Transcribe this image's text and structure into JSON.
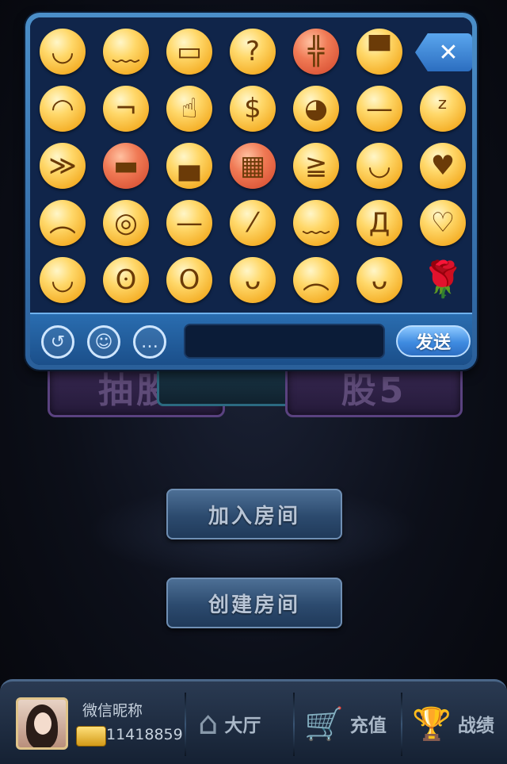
{
  "background": {
    "card_left_text": "抽股",
    "card_right_text": "股5"
  },
  "main": {
    "join_room_label": "加入房间",
    "create_room_label": "创建房间"
  },
  "emoji_panel": {
    "close_label": "✕",
    "emojis": [
      {
        "name": "smile",
        "glyph": "◡"
      },
      {
        "name": "embarrassed",
        "glyph": "﹏"
      },
      {
        "name": "scared",
        "glyph": "▭"
      },
      {
        "name": "confused",
        "glyph": "?"
      },
      {
        "name": "angry-crying",
        "glyph": "╬"
      },
      {
        "name": "vomit",
        "glyph": "▀"
      },
      {
        "name": "shy",
        "glyph": "◠"
      },
      {
        "name": "smug",
        "glyph": "¬"
      },
      {
        "name": "thumbs-up",
        "glyph": "☝"
      },
      {
        "name": "money-eyes",
        "glyph": "$"
      },
      {
        "name": "wink-grin",
        "glyph": "◕"
      },
      {
        "name": "sweat",
        "glyph": "—"
      },
      {
        "name": "sleepy",
        "glyph": "ᶻ"
      },
      {
        "name": "sneeze",
        "glyph": "≫"
      },
      {
        "name": "red-face",
        "glyph": "▬"
      },
      {
        "name": "cool",
        "glyph": "▄"
      },
      {
        "name": "gritted-teeth",
        "glyph": "▦"
      },
      {
        "name": "laughing",
        "glyph": "≧"
      },
      {
        "name": "content",
        "glyph": "◡"
      },
      {
        "name": "kiss",
        "glyph": "♥"
      },
      {
        "name": "displeased",
        "glyph": "︵"
      },
      {
        "name": "crying-eyes",
        "glyph": "◎"
      },
      {
        "name": "unimpressed",
        "glyph": "—"
      },
      {
        "name": "awkward",
        "glyph": "⁄"
      },
      {
        "name": "sweating-tears",
        "glyph": "﹏"
      },
      {
        "name": "wailing",
        "glyph": "Д"
      },
      {
        "name": "happy-heart",
        "glyph": "♡"
      },
      {
        "name": "calm-smile",
        "glyph": "◡"
      },
      {
        "name": "side-eye",
        "glyph": "ʘ"
      },
      {
        "name": "surprised",
        "glyph": "O"
      },
      {
        "name": "tongue-out",
        "glyph": "ᴗ"
      },
      {
        "name": "frown",
        "glyph": "︵"
      },
      {
        "name": "dizzy",
        "glyph": "ᴗ"
      },
      {
        "name": "rose",
        "glyph": "🌹"
      }
    ]
  },
  "chat_input": {
    "value": "",
    "send_label": "发送"
  },
  "bottom_bar": {
    "nickname": "微信昵称",
    "user_id": "11418859",
    "nav": [
      {
        "label": "大厅",
        "icon": "home-icon"
      },
      {
        "label": "充值",
        "icon": "cart-icon"
      },
      {
        "label": "战绩",
        "icon": "trophy-icon"
      }
    ]
  },
  "colors": {
    "panel_border": "#4b8fc9",
    "panel_bg": "#10254a",
    "send_button": "#3f8be0",
    "emoji_yellow": "#ffd86a"
  }
}
